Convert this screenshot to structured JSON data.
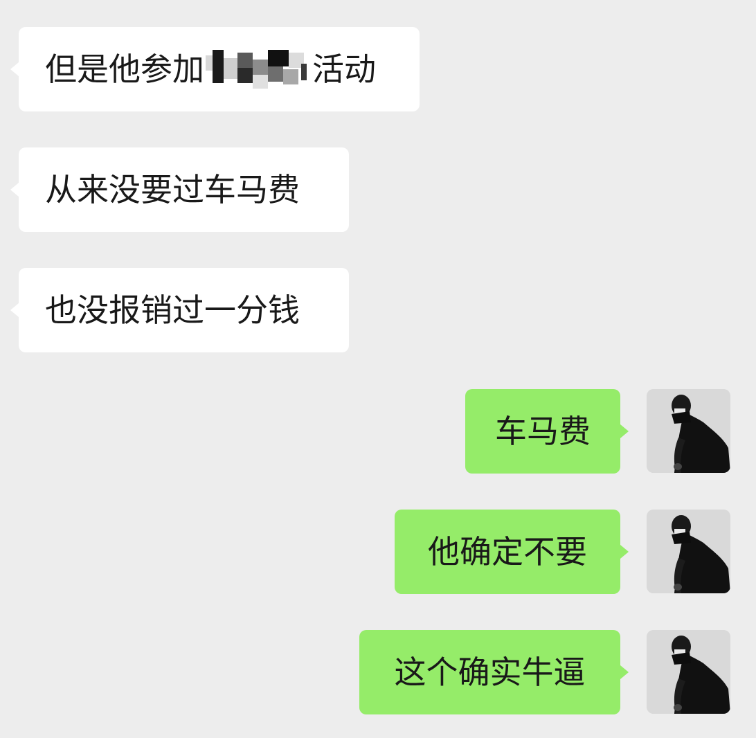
{
  "chat": {
    "messages": [
      {
        "side": "left",
        "text_before": "但是他参加",
        "text_after": "活动",
        "redacted": true
      },
      {
        "side": "left",
        "text": "从来没要过车马费"
      },
      {
        "side": "left",
        "text": "也没报销过一分钱"
      },
      {
        "side": "right",
        "text": "车马费"
      },
      {
        "side": "right",
        "text": "他确定不要"
      },
      {
        "side": "right",
        "text": "这个确实牛逼"
      }
    ]
  },
  "colors": {
    "background": "#ededed",
    "incoming_bubble": "#ffffff",
    "outgoing_bubble": "#95ec69",
    "text": "#191919"
  },
  "icons": {
    "avatar": "user-avatar-icon",
    "redaction": "pixel-mosaic"
  }
}
